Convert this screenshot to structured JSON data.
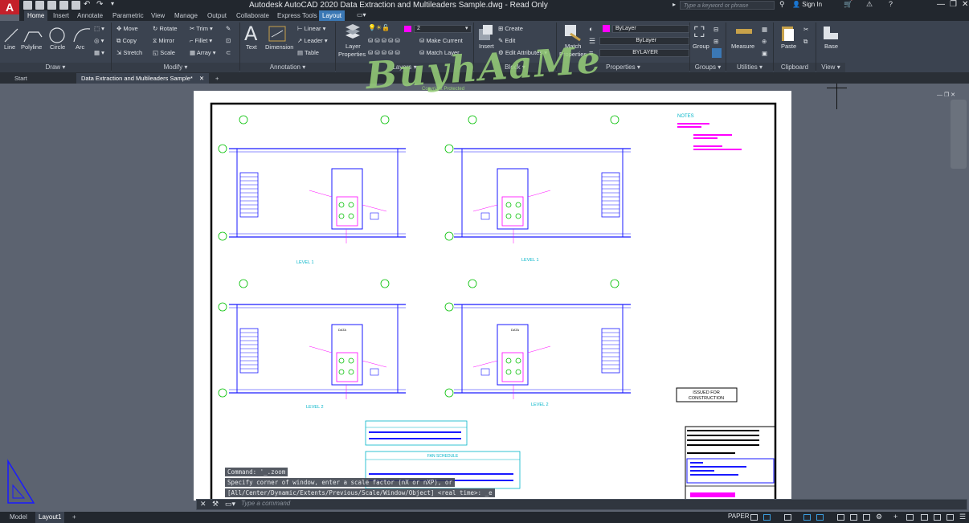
{
  "app": {
    "logo": "A",
    "title": "Autodesk AutoCAD 2020   Data Extraction and Multileaders Sample.dwg - Read Only",
    "search_placeholder": "Type a keyword or phrase",
    "sign_in": "Sign In"
  },
  "ribbon_tabs": [
    {
      "label": "Home",
      "active": true
    },
    {
      "label": "Insert"
    },
    {
      "label": "Annotate"
    },
    {
      "label": "Parametric"
    },
    {
      "label": "View"
    },
    {
      "label": "Manage"
    },
    {
      "label": "Output"
    },
    {
      "label": "Collaborate"
    },
    {
      "label": "Express Tools"
    },
    {
      "label": "Layout",
      "contextual": true
    }
  ],
  "draw": {
    "title": "Draw",
    "line": "Line",
    "polyline": "Polyline",
    "circle": "Circle",
    "arc": "Arc"
  },
  "modify": {
    "title": "Modify",
    "move": "Move",
    "rotate": "Rotate",
    "trim": "Trim",
    "copy": "Copy",
    "mirror": "Mirror",
    "fillet": "Fillet",
    "stretch": "Stretch",
    "scale": "Scale",
    "array": "Array"
  },
  "annotation": {
    "title": "Annotation",
    "text": "Text",
    "dimension": "Dimension",
    "linear": "Linear",
    "leader": "Leader",
    "table": "Table"
  },
  "layers": {
    "title": "Layers",
    "layer_properties_1": "Layer",
    "layer_properties_2": "Properties",
    "current_layer": "2",
    "make_current": "Make Current",
    "match_layer": "Match Layer"
  },
  "block": {
    "title": "Block",
    "insert": "Insert",
    "create": "Create",
    "edit": "Edit",
    "edit_attributes": "Edit Attributes"
  },
  "properties": {
    "title": "Properties",
    "match_1": "Match",
    "match_2": "Properties",
    "color": "ByLayer",
    "linetype": "ByLayer",
    "lineweight": "BYLAYER"
  },
  "groups": {
    "title": "Groups",
    "group": "Group"
  },
  "utilities": {
    "title": "Utilities",
    "measure": "Measure"
  },
  "clipboard": {
    "title": "Clipboard",
    "paste": "Paste"
  },
  "view": {
    "title": "View",
    "base": "Base"
  },
  "file_tabs": {
    "start": "Start",
    "document": "Data Extraction and Multileaders Sample*"
  },
  "watermark": {
    "text": "BuyhAaMe",
    "sub": "Copyright Protected"
  },
  "drawing": {
    "notes_title": "NOTES",
    "level_labels": [
      "LEVEL 1",
      "LEVEL 1",
      "LEVEL 2",
      "LEVEL 2"
    ],
    "issued_line1": "ISSUED FOR",
    "issued_line2": "CONSTRUCTION",
    "fan_schedule": "FAN SCHEDULE",
    "data_label": "DATA"
  },
  "command": {
    "history": [
      "Command: '_.zoom",
      "Specify corner of window, enter a scale factor (nX or nXP), or",
      "[All/Center/Dynamic/Extents/Previous/Scale/Window/Object] <real time>: _e"
    ],
    "placeholder": "Type a command"
  },
  "status": {
    "model": "Model",
    "layout1": "Layout1",
    "space": "PAPER"
  },
  "colors": {
    "accent": "#3b78b5",
    "draw_blue": "#1a1aff",
    "draw_magenta": "#ff00ff",
    "draw_green": "#00c000",
    "draw_cyan": "#00b4c8"
  }
}
